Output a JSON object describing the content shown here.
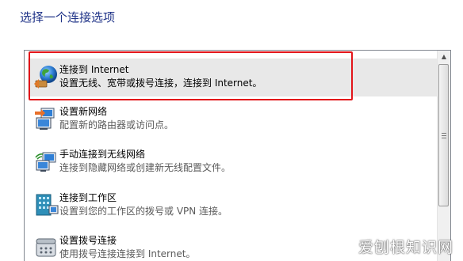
{
  "dialog": {
    "title": "选择一个连接选项"
  },
  "options": [
    {
      "name": "连接到 Internet",
      "description": "设置无线、宽带或拨号连接，连接到 Internet。",
      "icon": "globe-internet-icon",
      "selected": true
    },
    {
      "name": "设置新网络",
      "description": "配置新的路由器或访问点。",
      "icon": "network-computers-icon",
      "selected": false
    },
    {
      "name": "手动连接到无线网络",
      "description": "连接到隐藏网络或创建新无线配置文件。",
      "icon": "wireless-network-icon",
      "selected": false
    },
    {
      "name": "连接到工作区",
      "description": "设置到您的工作区的拨号或 VPN 连接。",
      "icon": "workplace-building-icon",
      "selected": false
    },
    {
      "name": "设置拨号连接",
      "description": "使用拨号连接连接到 Internet。",
      "icon": "dialup-phone-icon",
      "selected": false
    }
  ],
  "watermark": "爱刨根知识网",
  "colors": {
    "title": "#1e3287",
    "highlight_border": "#e3151a",
    "selected_bg": "#e8e8e8"
  }
}
